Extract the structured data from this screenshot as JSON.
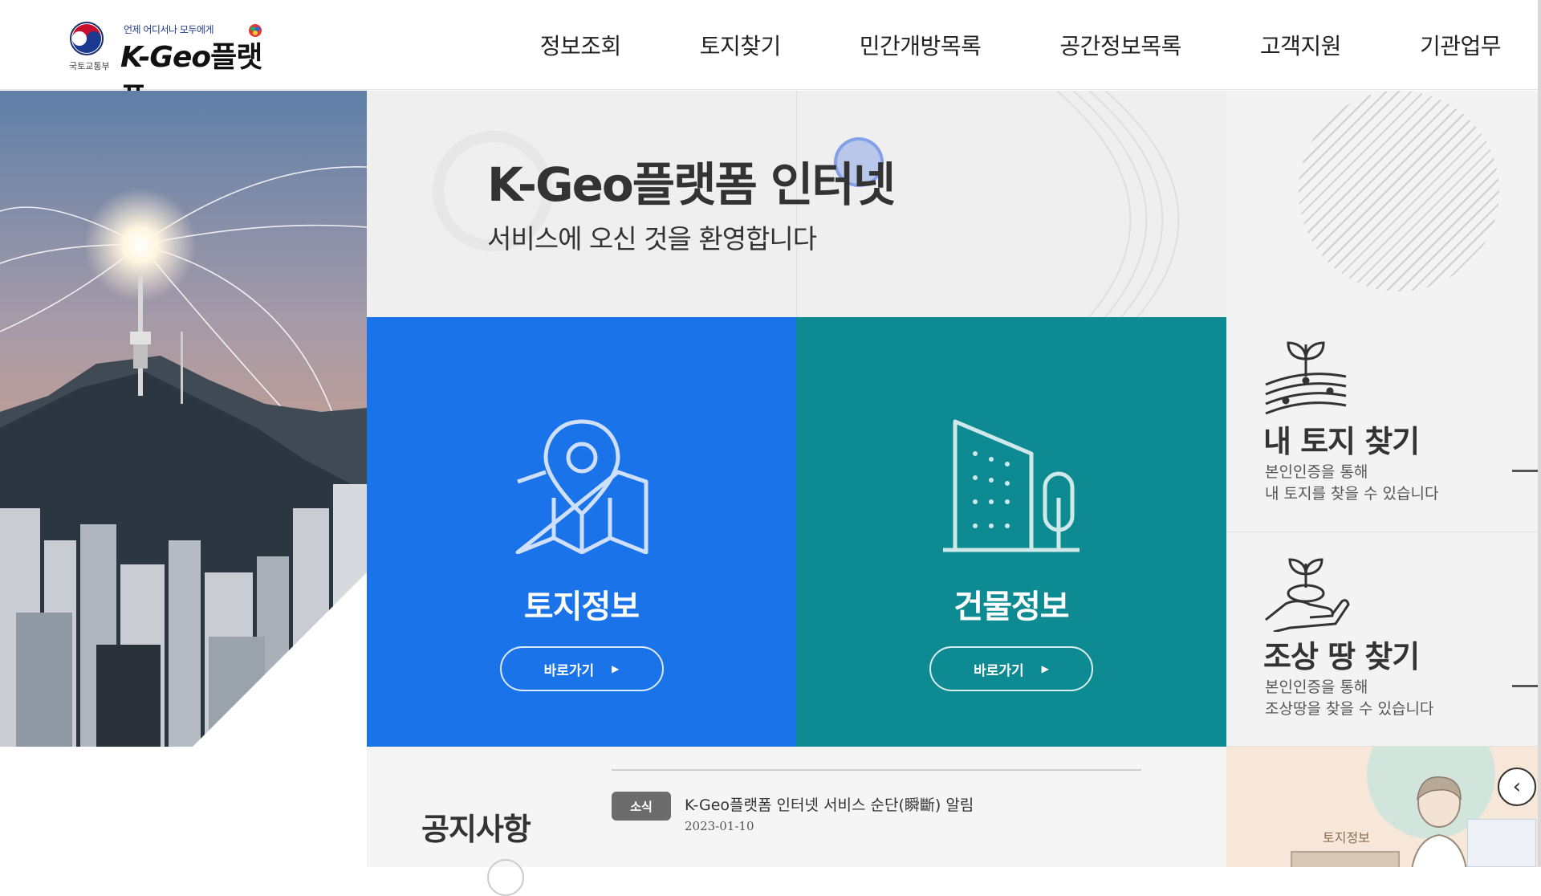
{
  "header": {
    "logo": {
      "slogan": "언제 어디서나 모두에게",
      "brand_latin": "K-Geo",
      "brand_korean": "플랫폼",
      "ministry": "국토교통부"
    },
    "nav": [
      "정보조회",
      "토지찾기",
      "민간개방목록",
      "공간정보목록",
      "고객지원",
      "기관업무"
    ]
  },
  "welcome": {
    "title": "K-Geo플랫폼 인터넷",
    "subtitle": "서비스에 오신 것을 환영합니다"
  },
  "tiles": {
    "land": {
      "label": "토지정보",
      "button": "바로가기",
      "icon": "map-pin-icon",
      "color": "#1a73e8"
    },
    "building": {
      "label": "건물정보",
      "button": "바로가기",
      "icon": "building-icon",
      "color": "#0e8a93"
    }
  },
  "side_cards": {
    "my_land": {
      "title": "내 토지 찾기",
      "desc1": "본인인증을 통해",
      "desc2": "내 토지를 찾을 수 있습니다",
      "icon": "sprout-land-icon"
    },
    "ancestor_land": {
      "title": "조상 땅 찾기",
      "desc1": "본인인증을 통해",
      "desc2": "조상땅을 찾을 수 있습니다",
      "icon": "hand-sprout-icon"
    }
  },
  "notice": {
    "title": "공지사항",
    "badge": "소식",
    "item_text": "K-Geo플랫폼 인터넷 서비스 순단(瞬斷) 알림",
    "item_date": "2023-01-10"
  },
  "promo": {
    "label": "토지정보",
    "prev_icon": "chevron-left-icon"
  }
}
